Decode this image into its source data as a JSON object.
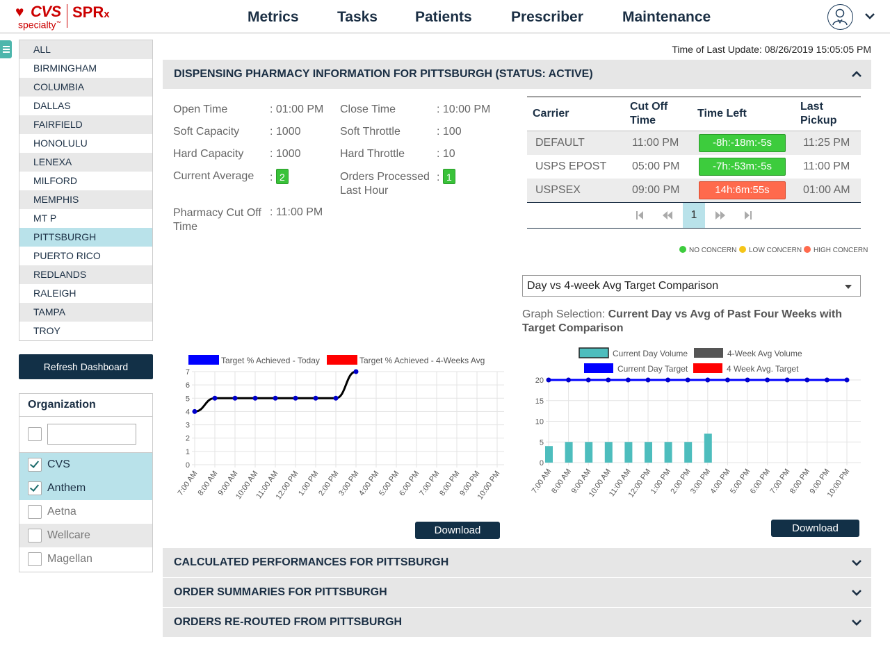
{
  "brand": {
    "cvs": "CVS",
    "specialty": "specialty",
    "tm": "™",
    "spr": "SPR",
    "x": "x"
  },
  "nav": [
    "Metrics",
    "Tasks",
    "Patients",
    "Prescriber",
    "Maintenance"
  ],
  "sidebar": {
    "cities": [
      "ALL",
      "BIRMINGHAM",
      "COLUMBIA",
      "DALLAS",
      "FAIRFIELD",
      "HONOLULU",
      "LENEXA",
      "MILFORD",
      "MEMPHIS",
      "MT P",
      "PITTSBURGH",
      "PUERTO RICO",
      "REDLANDS",
      "RALEIGH",
      "TAMPA",
      "TROY"
    ],
    "selected_city": "PITTSBURGH",
    "refresh_label": "Refresh Dashboard",
    "org_title": "Organization",
    "orgs": [
      {
        "name": "CVS",
        "checked": true
      },
      {
        "name": "Anthem",
        "checked": true
      },
      {
        "name": "Aetna",
        "checked": false
      },
      {
        "name": "Wellcare",
        "checked": false
      },
      {
        "name": "Magellan",
        "checked": false
      }
    ]
  },
  "last_update": "Time of Last Update: 08/26/2019 15:05:05 PM",
  "sections": {
    "dispensing": "DISPENSING PHARMACY INFORMATION FOR PITTSBURGH (STATUS: ACTIVE)",
    "calculated": "CALCULATED PERFORMANCES FOR PITTSBURGH",
    "orders": "ORDER SUMMARIES FOR PITTSBURGH",
    "rerouted": "ORDERS RE-ROUTED FROM PITTSBURGH"
  },
  "info": {
    "open_time_label": "Open Time",
    "open_time": ": 01:00 PM",
    "close_time_label": "Close Time",
    "close_time": ": 10:00 PM",
    "soft_capacity_label": "Soft Capacity",
    "soft_capacity": ": 1000",
    "soft_throttle_label": "Soft Throttle",
    "soft_throttle": ": 100",
    "hard_capacity_label": "Hard Capacity",
    "hard_capacity": ": 1000",
    "hard_throttle_label": "Hard Throttle",
    "hard_throttle": ": 10",
    "current_avg_label": "Current Average",
    "current_avg": "2",
    "orders_processed_label_1": "Orders Processed",
    "orders_processed_label_2": "Last Hour",
    "orders_processed": "1",
    "cutoff_label_1": "Pharmacy Cut Off",
    "cutoff_label_2": "Time",
    "cutoff": ": 11:00 PM",
    "colon": ":"
  },
  "carriers": {
    "headers": {
      "carrier": "Carrier",
      "cutoff_1": "Cut Off",
      "cutoff_2": "Time",
      "time_left": "Time Left",
      "last_1": "Last",
      "last_2": "Pickup"
    },
    "rows": [
      {
        "carrier": "DEFAULT",
        "cutoff": "11:00 PM",
        "time_left": "-8h:-18m:-5s",
        "status_color": "#3dcc3d",
        "last": "11:25 PM"
      },
      {
        "carrier": "USPS EPOST",
        "cutoff": "05:00 PM",
        "time_left": "-7h:-53m:-5s",
        "status_color": "#3dcc3d",
        "last": "11:00 PM"
      },
      {
        "carrier": "USPSEX",
        "cutoff": "09:00 PM",
        "time_left": "14h:6m:55s",
        "status_color": "#ff6a4d",
        "last": "01:00 AM"
      }
    ],
    "page": "1"
  },
  "concern_legend": [
    {
      "label": "NO CONCERN",
      "color": "#3dcc3d"
    },
    {
      "label": "LOW CONCERN",
      "color": "#f5c518"
    },
    {
      "label": "HIGH CONCERN",
      "color": "#ff6a4d"
    }
  ],
  "graph_dropdown": "Day vs 4-week Avg Target Comparison",
  "graph_selection_label": "Graph Selection: ",
  "graph_selection_value": "Current Day vs Avg of Past Four Weeks with Target Comparison",
  "download_label": "Download",
  "chart_data": [
    {
      "type": "line",
      "categories": [
        "7:00 AM",
        "8:00 AM",
        "9:00 AM",
        "10:00 AM",
        "11:00 AM",
        "12:00 PM",
        "1:00 PM",
        "2:00 PM",
        "3:00 PM",
        "4:00 PM",
        "5:00 PM",
        "6:00 PM",
        "7:00 PM",
        "8:00 PM",
        "9:00 PM",
        "10:00 PM"
      ],
      "legend": [
        {
          "label": "Target % Achieved - Today",
          "color": "#0000ff"
        },
        {
          "label": "Target % Achieved - 4-Weeks Avg",
          "color": "#ff0000"
        }
      ],
      "series": [
        {
          "name": "Target % Achieved - Today",
          "color": "#000000",
          "point_color": "#0000cc",
          "values": [
            4,
            5,
            5,
            5,
            5,
            5,
            5,
            5,
            7
          ]
        }
      ],
      "ylim": [
        0,
        7
      ],
      "yticks": [
        0,
        1,
        2,
        3,
        4,
        5,
        6,
        7
      ],
      "grid": true
    },
    {
      "type": "bar",
      "categories": [
        "7:00 AM",
        "8:00 AM",
        "9:00 AM",
        "10:00 AM",
        "11:00 AM",
        "12:00 PM",
        "1:00 PM",
        "2:00 PM",
        "3:00 PM",
        "4:00 PM",
        "5:00 PM",
        "6:00 PM",
        "7:00 PM",
        "8:00 PM",
        "9:00 PM",
        "10:00 PM"
      ],
      "legend": [
        {
          "label": "Current Day Volume",
          "color": "#4dbdbd"
        },
        {
          "label": "4-Week Avg Volume",
          "color": "#555555"
        },
        {
          "label": "Current Day Target",
          "color": "#0000ff"
        },
        {
          "label": "4 Week Avg. Target",
          "color": "#ff0000"
        }
      ],
      "series": [
        {
          "name": "Current Day Volume",
          "kind": "bar",
          "color": "#4dbdbd",
          "values": [
            4,
            5,
            5,
            5,
            5,
            5,
            5,
            5,
            7
          ]
        },
        {
          "name": "Current Day Target",
          "kind": "line",
          "color": "#0000ff",
          "values": [
            20,
            20,
            20,
            20,
            20,
            20,
            20,
            20,
            20,
            20,
            20,
            20,
            20,
            20,
            20,
            20
          ]
        }
      ],
      "ylim": [
        0,
        20
      ],
      "yticks": [
        0,
        5,
        10,
        15,
        20
      ],
      "grid": true
    }
  ]
}
